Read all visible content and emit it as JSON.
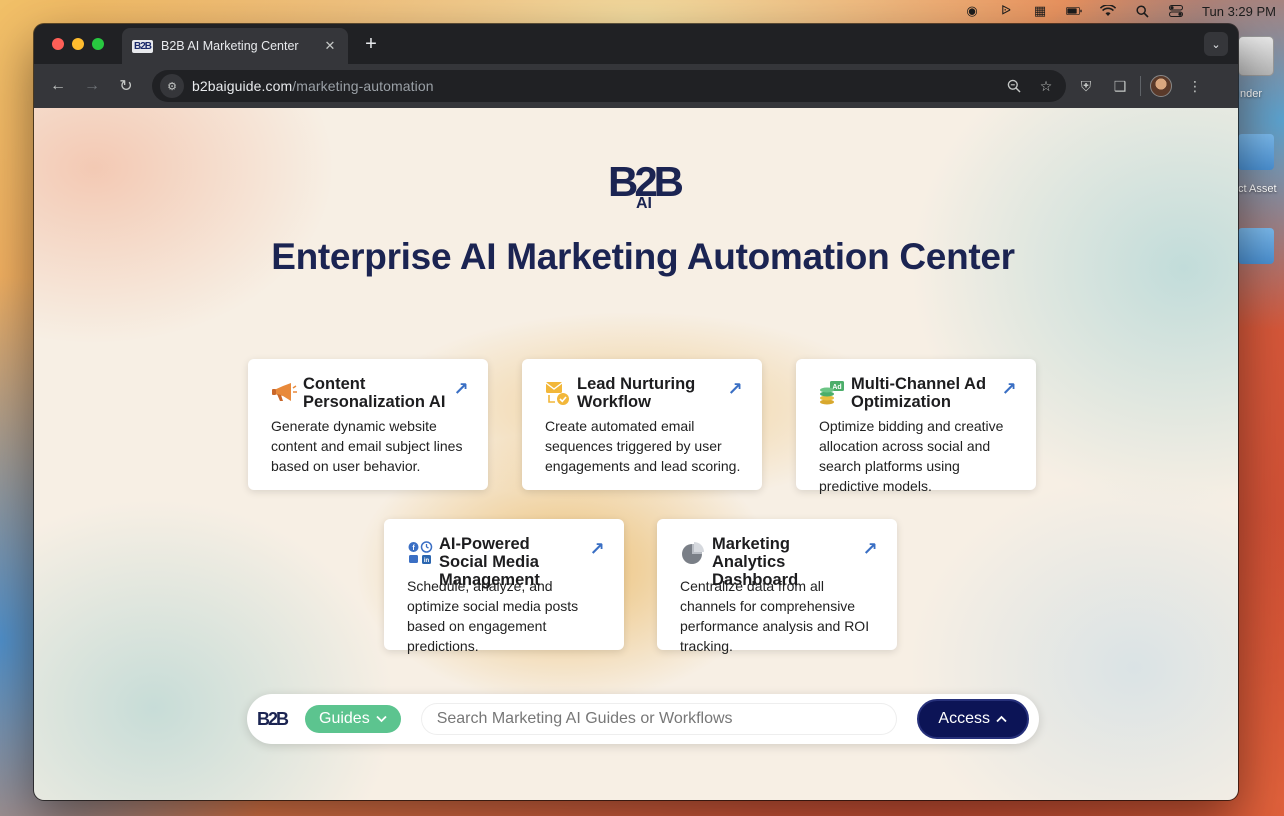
{
  "menubar": {
    "clock": "Tun 3:29 PM",
    "icons": [
      "focus-icon",
      "bluetooth-icon",
      "keyboard-icon",
      "battery-icon",
      "wifi-icon",
      "spotlight-icon",
      "control-center-icon"
    ]
  },
  "desktop": {
    "items": [
      {
        "label": "nder",
        "icon": "drive-icon"
      },
      {
        "label": "ct Asset",
        "icon": "folder-icon"
      },
      {
        "label": "",
        "icon": "folder-icon"
      }
    ]
  },
  "browser": {
    "tab_title": "B2B AI Marketing Center",
    "favicon_text": "B2B",
    "url_domain": "b2baiguide.com",
    "url_path": "/marketing-automation"
  },
  "page": {
    "logo_top": "B2B",
    "logo_bottom": "AI",
    "title": "Enterprise AI Marketing Automation Center",
    "cards": [
      {
        "title": "Content Personalization AI",
        "description": "Generate dynamic website content and email subject lines based on user behavior.",
        "icon": "megaphone-icon"
      },
      {
        "title": "Lead Nurturing Workflow",
        "description": "Create automated email sequences triggered by user engagements and lead scoring.",
        "icon": "email-workflow-icon"
      },
      {
        "title": "Multi-Channel Ad Optimization",
        "description": "Optimize bidding and creative allocation across social and search platforms using predictive models.",
        "icon": "ad-budget-icon"
      },
      {
        "title": "AI-Powered Social Media Management",
        "description": "Schedule, analyze, and optimize social media posts based on engagement predictions.",
        "icon": "social-media-icon"
      },
      {
        "title": "Marketing Analytics Dashboard",
        "description": "Centralize data from all channels for comprehensive performance analysis and ROI tracking.",
        "icon": "pie-chart-icon"
      }
    ]
  },
  "bottombar": {
    "logo": "B2B",
    "guides_label": "Guides",
    "search_placeholder": "Search Marketing AI Guides or Workflows",
    "access_label": "Access"
  },
  "colors": {
    "brand_navy": "#1b2452",
    "access_button": "#0c1456",
    "guides_button": "#5cc48f",
    "arrow_blue": "#3a6fc4"
  }
}
